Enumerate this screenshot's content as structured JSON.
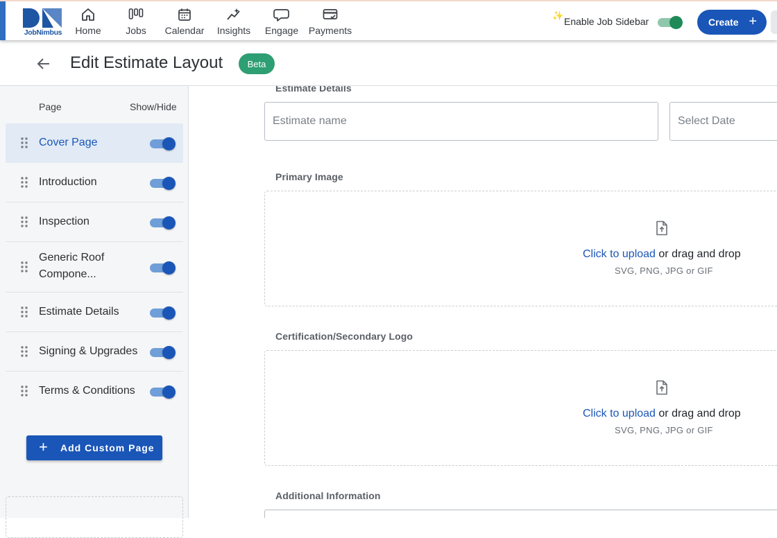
{
  "brand": {
    "name": "JobNimbus",
    "color": "#1a56b8"
  },
  "nav": [
    {
      "label": "Home",
      "icon": "home-icon"
    },
    {
      "label": "Jobs",
      "icon": "jobs-board-icon"
    },
    {
      "label": "Calendar",
      "icon": "calendar-icon"
    },
    {
      "label": "Insights",
      "icon": "insights-sparkle-icon"
    },
    {
      "label": "Engage",
      "icon": "chat-bubble-icon"
    },
    {
      "label": "Payments",
      "icon": "wallet-card-icon"
    }
  ],
  "topbar": {
    "enable_sidebar_label": "Enable Job Sidebar",
    "enable_sidebar_on": true,
    "create_label": "Create"
  },
  "header": {
    "title": "Edit Estimate Layout",
    "badge": "Beta"
  },
  "pages_panel": {
    "col_page": "Page",
    "col_show_hide": "Show/Hide",
    "items": [
      {
        "label": "Cover Page",
        "shown": true,
        "active": true
      },
      {
        "label": "Introduction",
        "shown": true
      },
      {
        "label": "Inspection",
        "shown": true
      },
      {
        "label": "Generic Roof",
        "label2": "Compone...",
        "shown": true
      },
      {
        "label": "Estimate Details",
        "shown": true
      },
      {
        "label": "Signing & Upgrades",
        "shown": true
      },
      {
        "label": "Terms & Conditions",
        "shown": true
      }
    ],
    "add_button": "Add Custom Page"
  },
  "form": {
    "section_estimate_details": "Estimate Details",
    "estimate_name_placeholder": "Estimate name",
    "date_placeholder": "Select Date",
    "primary_image_label": "Primary Image",
    "cert_logo_label": "Certification/Secondary Logo",
    "additional_info_label": "Additional Information",
    "upload": {
      "link": "Click to upload",
      "rest": " or drag and drop",
      "formats": "SVG, PNG, JPG or GIF"
    }
  }
}
